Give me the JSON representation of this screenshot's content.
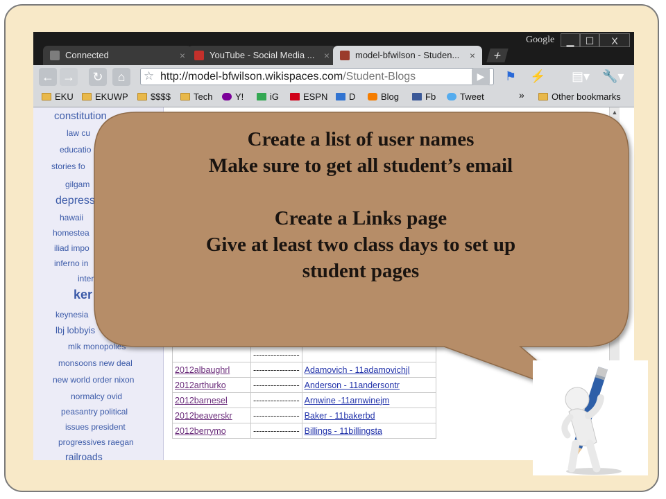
{
  "browser": {
    "tabs": [
      {
        "label": "Connected",
        "active": false
      },
      {
        "label": "YouTube - Social Media ...",
        "active": false
      },
      {
        "label": "model-bfwilson - Studen...",
        "active": true
      }
    ],
    "tab_close": "×",
    "new_tab_label": "+",
    "brand_label": "Google",
    "window_buttons": {
      "minimize": "▁",
      "maximize": "☐",
      "close": "X"
    },
    "url_host": "http://model-bfwilson.wikispaces.com",
    "url_path": "/Student-Blogs",
    "bookmarks": [
      {
        "label": "EKU",
        "icon": "folder-icon"
      },
      {
        "label": "EKUWP",
        "icon": "folder-icon"
      },
      {
        "label": "$$$$",
        "icon": "folder-icon"
      },
      {
        "label": "Tech",
        "icon": "folder-icon"
      },
      {
        "label": "Y!",
        "icon": "yahoo-icon"
      },
      {
        "label": "iG",
        "icon": "igoogle-icon"
      },
      {
        "label": "ESPN",
        "icon": "espn-icon"
      },
      {
        "label": "D",
        "icon": "delicious-icon"
      },
      {
        "label": "Blog",
        "icon": "blogger-icon"
      },
      {
        "label": "Fb",
        "icon": "facebook-icon"
      },
      {
        "label": "Tweet",
        "icon": "twitter-icon"
      }
    ],
    "bookmarks_overflow": "»",
    "other_bookmarks": "Other bookmarks"
  },
  "tag_cloud": [
    {
      "text": "constitution",
      "size": 15
    },
    {
      "text": "law cu",
      "size": 12
    },
    {
      "text": "educatio",
      "size": 12
    },
    {
      "text": "stories fo",
      "size": 12
    },
    {
      "text": "gilgam",
      "size": 12
    },
    {
      "text": "depress",
      "size": 16
    },
    {
      "text": "hawaii",
      "size": 12
    },
    {
      "text": "homestea",
      "size": 12
    },
    {
      "text": "iliad impo",
      "size": 12
    },
    {
      "text": "inferno in",
      "size": 12
    },
    {
      "text": "inter",
      "size": 12
    },
    {
      "text": "ker",
      "size": 18
    },
    {
      "text": "keynesia",
      "size": 12
    },
    {
      "text": "lbj lobbyis",
      "size": 13
    },
    {
      "text": "mlk monopolies",
      "size": 12
    },
    {
      "text": "monsoons new deal",
      "size": 12
    },
    {
      "text": "new world order nixon",
      "size": 12
    },
    {
      "text": "normalcy ovid",
      "size": 12
    },
    {
      "text": "peasantry political",
      "size": 12
    },
    {
      "text": "issues president",
      "size": 12
    },
    {
      "text": "progressives raegan",
      "size": 12
    },
    {
      "text": "railroads",
      "size": 14
    }
  ],
  "table": {
    "rows": [
      {
        "user": "",
        "sep": "----------------",
        "name": ""
      },
      {
        "user": "2012albaughrl",
        "sep": "----------------",
        "name": "Adamovich - 11adamovichjl"
      },
      {
        "user": "2012arthurko",
        "sep": "----------------",
        "name": "Anderson - 11andersontr"
      },
      {
        "user": "2012barnesel",
        "sep": "----------------",
        "name": "Arnwine -11arnwinejm"
      },
      {
        "user": "2012beaverskr",
        "sep": "----------------",
        "name": "Baker - 11bakerbd"
      },
      {
        "user": "2012berrymo",
        "sep": "----------------",
        "name": "Billings - 11billingsta"
      }
    ]
  },
  "callout": {
    "lines": [
      "Create a list of user names",
      "Make sure to get all student’s email",
      "",
      "Create a Links page",
      "Give at least two class days to set up",
      "student pages"
    ],
    "fill_color": "#b68d67"
  },
  "colors": {
    "slide_background": "#f8e9c8",
    "link": "#3b5aa8"
  }
}
